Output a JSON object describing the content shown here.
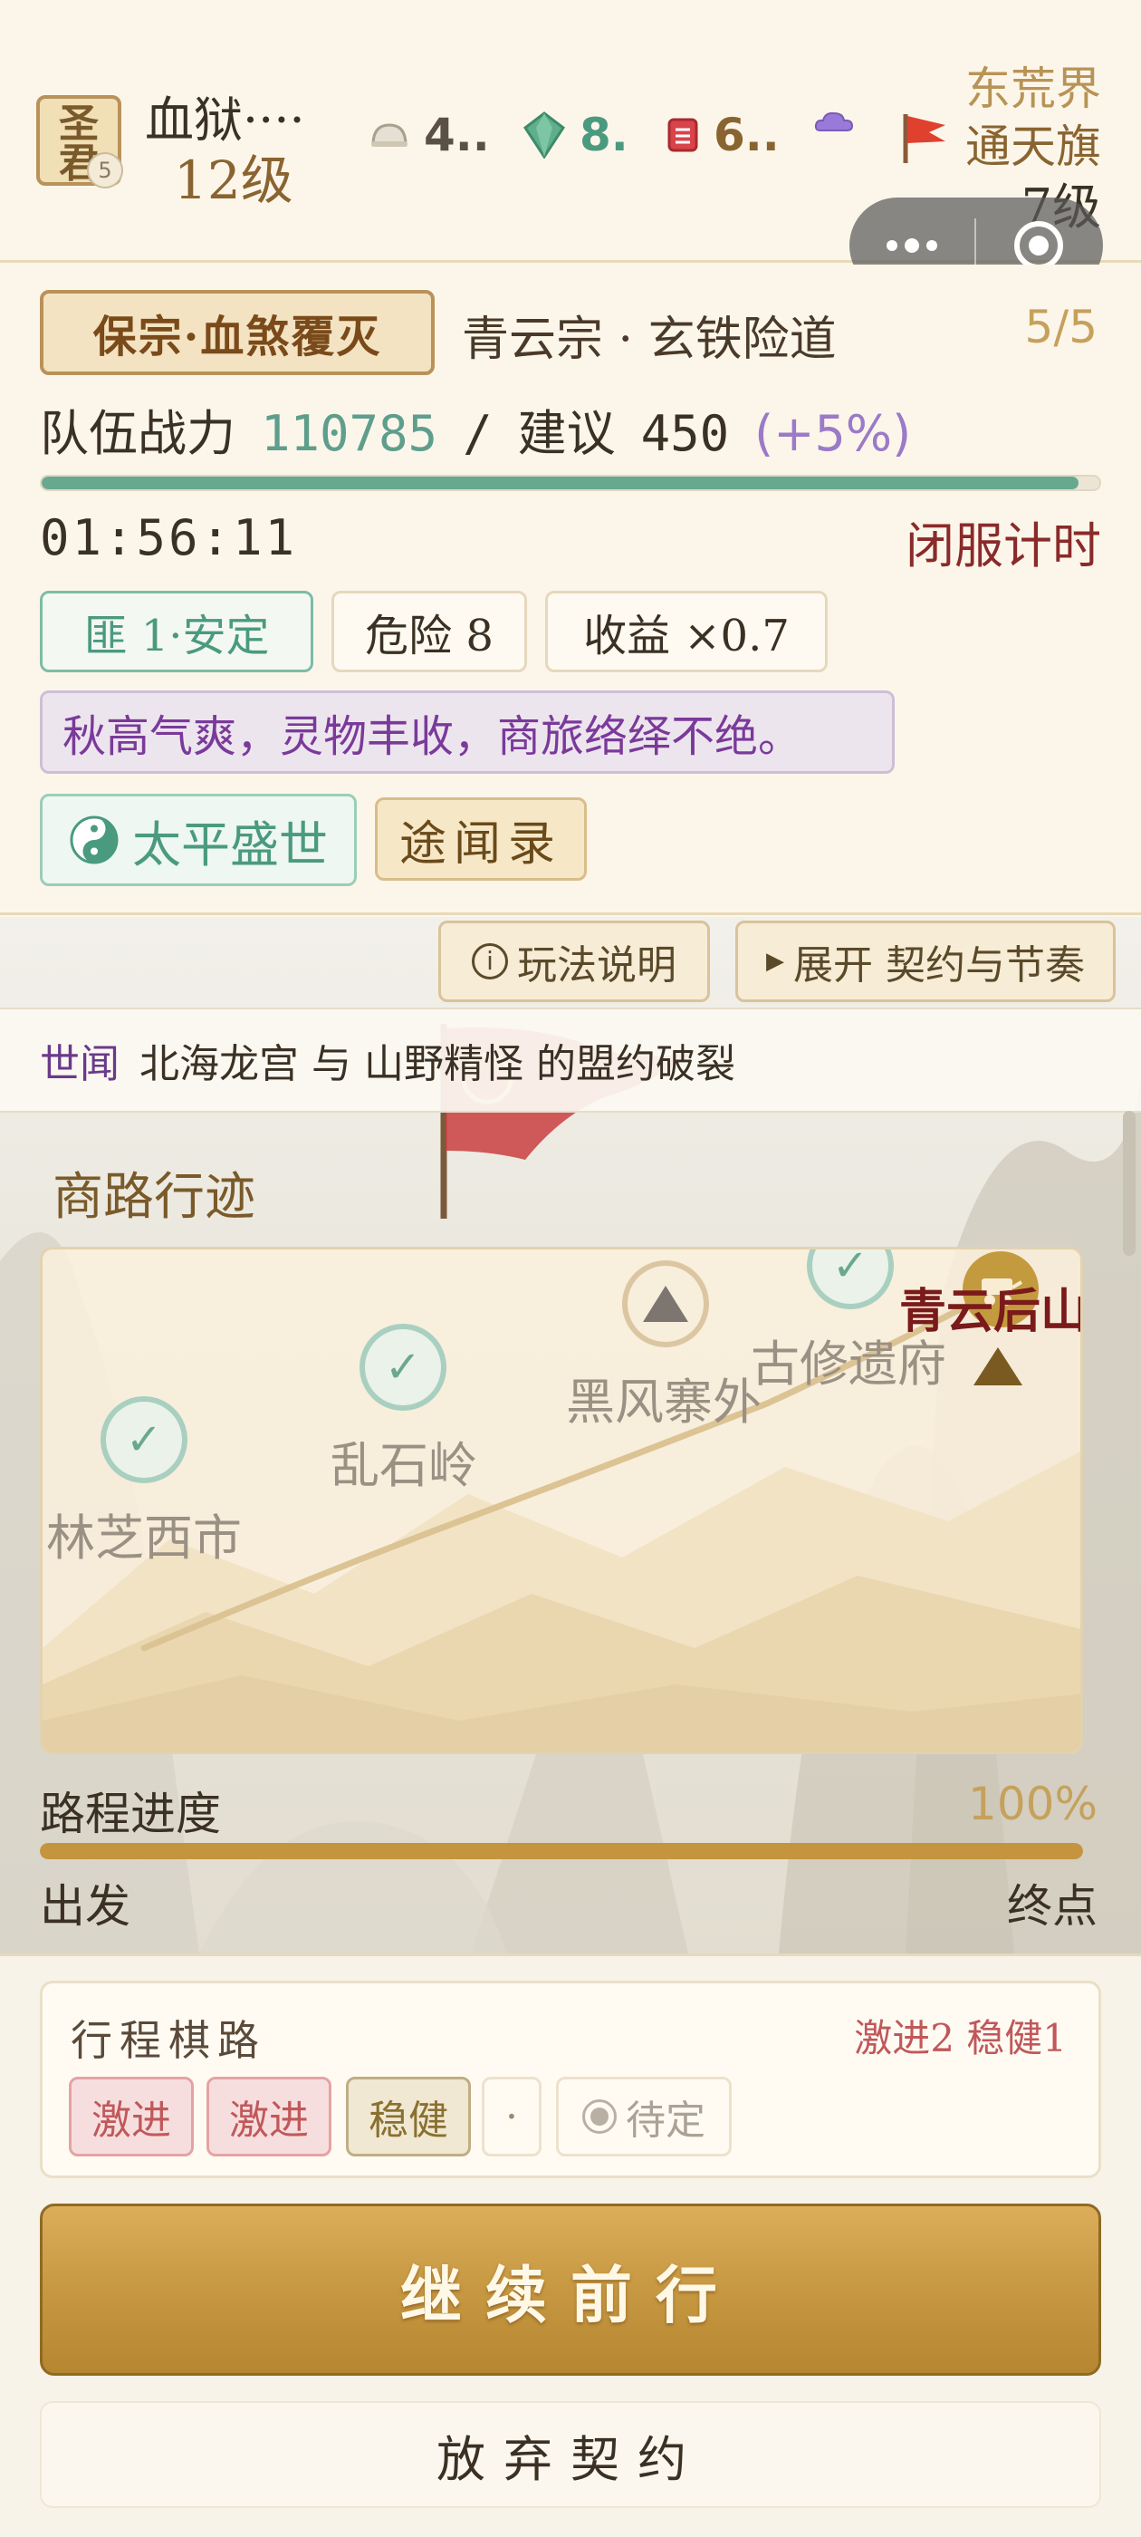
{
  "player": {
    "avatar_title": "圣君",
    "avatar_badge": "5",
    "name": "血狱····",
    "level": "12级"
  },
  "resources": [
    {
      "icon": "helmet-icon",
      "value": "4..",
      "color": "#5a5046"
    },
    {
      "icon": "jade-gem-icon",
      "value": "8.",
      "color": "#4a9a80"
    },
    {
      "icon": "scroll-box-icon",
      "value": "6..",
      "color": "#8a6430"
    },
    {
      "icon": "cloud-icon",
      "value": "",
      "color": "#8a6ad0"
    }
  ],
  "realm": "东荒界",
  "flag": {
    "icon": "red-flag-icon",
    "name": "通天旗",
    "level": "7级"
  },
  "mission": {
    "tag": "保宗·血煞覆灭",
    "route": "青云宗 · 玄铁险道",
    "count": "5/5",
    "power_label": "队伍战力",
    "power_value": "110785",
    "separator": "/",
    "recommend_label": "建议",
    "recommend_value": "450",
    "bonus": "(+5%)",
    "power_progress": 0.98,
    "timer": "01:56:11",
    "timer_label": "闭服计时"
  },
  "chips": {
    "bandit": "匪 1·安定",
    "danger": "危险 8",
    "income": "收益 ×0.7"
  },
  "season_text": "秋高气爽，灵物丰收，商旅络绎不绝。",
  "buttons": {
    "peace": "太平盛世",
    "news": "途闻录",
    "help": "玩法说明",
    "expand": "展开 契约与节奏",
    "continue": "继续前行",
    "abandon": "放弃契约"
  },
  "news": {
    "label": "世闻",
    "text": "北海龙宫 与 山野精怪 的盟约破裂"
  },
  "map": {
    "title": "商路行迹",
    "nodes": [
      {
        "label": "林芝西市",
        "state": "done"
      },
      {
        "label": "乱石岭",
        "state": "done"
      },
      {
        "label": "黑风寨外",
        "state": "danger"
      },
      {
        "label": "古修遗府",
        "state": "done"
      },
      {
        "label": "青云后山",
        "state": "current"
      }
    ]
  },
  "route_progress": {
    "label": "路程进度",
    "value": "100%",
    "fraction": 1.0,
    "start": "出发",
    "end": "终点"
  },
  "chess": {
    "title": "行程棋路",
    "summary": "激进2 稳健1",
    "moves": [
      "激进",
      "激进",
      "稳健",
      "·"
    ],
    "pending": "待定"
  }
}
